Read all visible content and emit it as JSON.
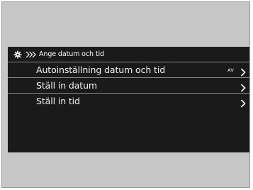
{
  "header": {
    "icon": "gear-icon",
    "separator": "breadcrumb-chevrons",
    "title": "Ange datum och tid"
  },
  "menu": {
    "items": [
      {
        "label": "Autoinställning datum och tid",
        "value": "AV",
        "icon": "chevron-right-icon"
      },
      {
        "label": "Ställ in datum",
        "value": "",
        "icon": "chevron-right-icon"
      },
      {
        "label": "Ställ in tid",
        "value": "",
        "icon": "chevron-right-icon"
      }
    ]
  },
  "colors": {
    "screen_bg": "#1a1a1a",
    "frame_bg": "#c6c6c6",
    "text": "#f2f2f2",
    "divider": "#8a8a8a"
  }
}
